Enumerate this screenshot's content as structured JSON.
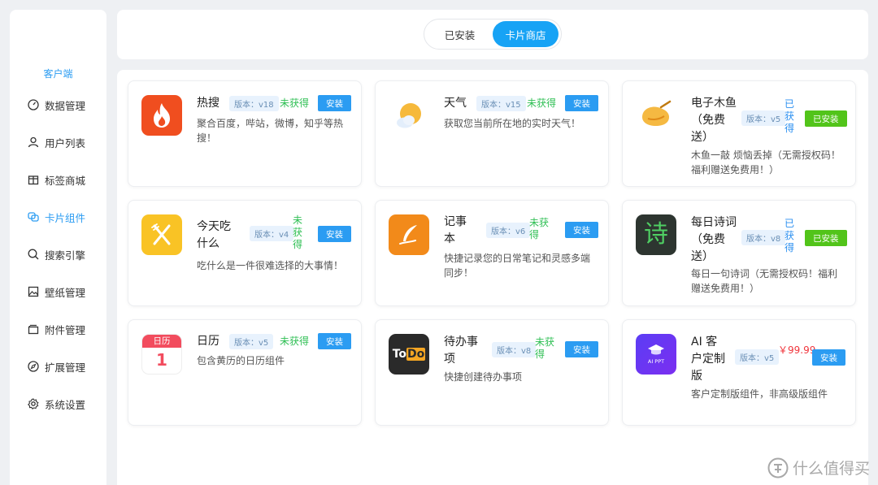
{
  "sidebar": {
    "title": "客户端",
    "items": [
      {
        "label": "数据管理",
        "icon": "dashboard-icon"
      },
      {
        "label": "用户列表",
        "icon": "user-icon"
      },
      {
        "label": "标签商城",
        "icon": "box-icon"
      },
      {
        "label": "卡片组件",
        "icon": "cards-icon",
        "active": true
      },
      {
        "label": "搜索引擎",
        "icon": "search-icon"
      },
      {
        "label": "壁纸管理",
        "icon": "image-icon"
      },
      {
        "label": "附件管理",
        "icon": "folder-icon"
      },
      {
        "label": "扩展管理",
        "icon": "compass-icon"
      },
      {
        "label": "系统设置",
        "icon": "gear-icon"
      }
    ]
  },
  "tabs": {
    "installed": "已安装",
    "store": "卡片商店",
    "active": "store"
  },
  "cards": [
    {
      "name": "热搜",
      "version": "版本：v18",
      "status": "未获得",
      "button": "安装",
      "desc": "聚合百度，哔站，微博，知乎等热搜！",
      "icon": "fire-icon"
    },
    {
      "name": "天气",
      "version": "版本：v15",
      "status": "未获得",
      "button": "安装",
      "desc": "获取您当前所在地的实时天气！",
      "icon": "weather-icon"
    },
    {
      "name": "电子木鱼（免费送）",
      "version": "版本：v5",
      "status": "已获得",
      "button": "已安装",
      "desc": "木鱼一敲 烦恼丢掉（无需授权码！福利赠送免费用！）",
      "icon": "woodfish-icon"
    },
    {
      "name": "今天吃什么",
      "version": "版本：v4",
      "status": "未获得",
      "button": "安装",
      "desc": "吃什么是一件很难选择的大事情！",
      "icon": "fork-knife-icon"
    },
    {
      "name": "记事本",
      "version": "版本：v6",
      "status": "未获得",
      "button": "安装",
      "desc": "快捷记录您的日常笔记和灵感多端同步！",
      "icon": "feather-icon"
    },
    {
      "name": "每日诗词（免费送）",
      "version": "版本：v8",
      "status": "已获得",
      "button": "已安装",
      "desc": "每日一句诗词（无需授权码！福利赠送免费用！）",
      "icon": "poem-icon",
      "icon_text": "诗"
    },
    {
      "name": "日历",
      "version": "版本：v5",
      "status": "未获得",
      "button": "安装",
      "desc": "包含黄历的日历组件",
      "icon": "calendar-icon",
      "icon_header": "日历",
      "icon_day": "1"
    },
    {
      "name": "待办事项",
      "version": "版本：v8",
      "status": "未获得",
      "button": "安装",
      "desc": "快捷创建待办事项",
      "icon": "todo-icon",
      "icon_to": "To",
      "icon_do": "Do"
    },
    {
      "name": "AI 客户定制版",
      "version": "版本：v5",
      "status": "￥99.99",
      "button": "安装",
      "desc": "客户定制版组件，非高级版组件",
      "icon": "ai-ppt-icon",
      "icon_text": "AI PPT"
    }
  ],
  "watermark": "什么值得买",
  "colors": {
    "accent": "#17a3f5",
    "green": "#52c41a",
    "status_green": "#2fbf54",
    "status_blue": "#2b8ff0",
    "price_red": "#f0343b"
  }
}
